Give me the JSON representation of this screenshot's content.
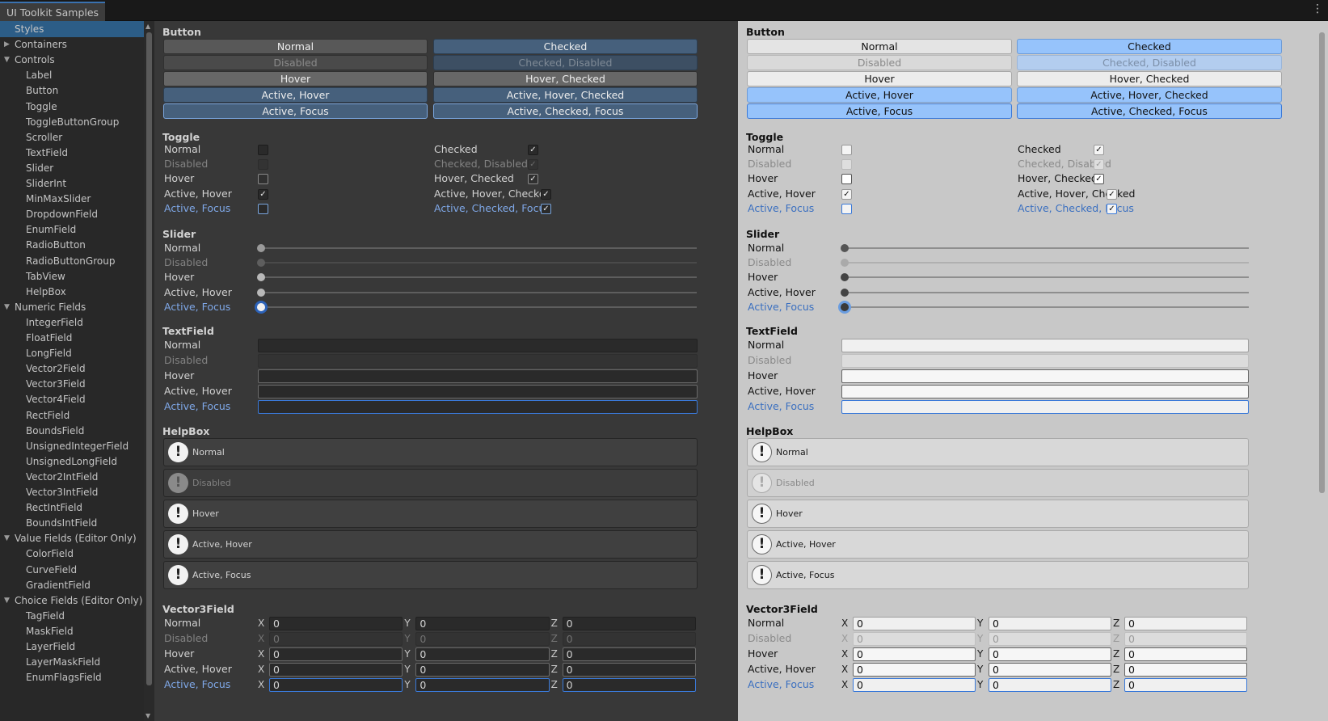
{
  "window": {
    "tab_title": "UI Toolkit Samples",
    "menu_icon": "kebab-menu-icon"
  },
  "sidebar": {
    "items": [
      {
        "label": "Styles",
        "level": 1,
        "selected": true,
        "arrow": ""
      },
      {
        "label": "Containers",
        "level": 1,
        "arrow": "▶"
      },
      {
        "label": "Controls",
        "level": 1,
        "arrow": "▼"
      },
      {
        "label": "Label",
        "level": 2
      },
      {
        "label": "Button",
        "level": 2
      },
      {
        "label": "Toggle",
        "level": 2
      },
      {
        "label": "ToggleButtonGroup",
        "level": 2
      },
      {
        "label": "Scroller",
        "level": 2
      },
      {
        "label": "TextField",
        "level": 2
      },
      {
        "label": "Slider",
        "level": 2
      },
      {
        "label": "SliderInt",
        "level": 2
      },
      {
        "label": "MinMaxSlider",
        "level": 2
      },
      {
        "label": "DropdownField",
        "level": 2
      },
      {
        "label": "EnumField",
        "level": 2
      },
      {
        "label": "RadioButton",
        "level": 2
      },
      {
        "label": "RadioButtonGroup",
        "level": 2
      },
      {
        "label": "TabView",
        "level": 2
      },
      {
        "label": "HelpBox",
        "level": 2
      },
      {
        "label": "Numeric Fields",
        "level": 1,
        "arrow": "▼"
      },
      {
        "label": "IntegerField",
        "level": 2
      },
      {
        "label": "FloatField",
        "level": 2
      },
      {
        "label": "LongField",
        "level": 2
      },
      {
        "label": "Vector2Field",
        "level": 2
      },
      {
        "label": "Vector3Field",
        "level": 2
      },
      {
        "label": "Vector4Field",
        "level": 2
      },
      {
        "label": "RectField",
        "level": 2
      },
      {
        "label": "BoundsField",
        "level": 2
      },
      {
        "label": "UnsignedIntegerField",
        "level": 2
      },
      {
        "label": "UnsignedLongField",
        "level": 2
      },
      {
        "label": "Vector2IntField",
        "level": 2
      },
      {
        "label": "Vector3IntField",
        "level": 2
      },
      {
        "label": "RectIntField",
        "level": 2
      },
      {
        "label": "BoundsIntField",
        "level": 2
      },
      {
        "label": "Value Fields (Editor Only)",
        "level": 1,
        "arrow": "▼"
      },
      {
        "label": "ColorField",
        "level": 2
      },
      {
        "label": "CurveField",
        "level": 2
      },
      {
        "label": "GradientField",
        "level": 2
      },
      {
        "label": "Choice Fields (Editor Only)",
        "level": 1,
        "arrow": "▼"
      },
      {
        "label": "TagField",
        "level": 2
      },
      {
        "label": "MaskField",
        "level": 2
      },
      {
        "label": "LayerField",
        "level": 2
      },
      {
        "label": "LayerMaskField",
        "level": 2
      },
      {
        "label": "EnumFlagsField",
        "level": 2
      }
    ]
  },
  "sections": {
    "button": {
      "title": "Button",
      "left": [
        "Normal",
        "Disabled",
        "Hover",
        "Active, Hover",
        "Active, Focus"
      ],
      "right": [
        "Checked",
        "Checked, Disabled",
        "Hover, Checked",
        "Active, Hover, Checked",
        "Active, Checked, Focus"
      ]
    },
    "toggle": {
      "title": "Toggle",
      "left": [
        "Normal",
        "Disabled",
        "Hover",
        "Active, Hover",
        "Active, Focus"
      ],
      "left_checked": [
        false,
        false,
        false,
        true,
        false
      ],
      "right": [
        "Checked",
        "Checked, Disabled",
        "Hover, Checked",
        "Active, Hover, Checked",
        "Active, Checked, Focus"
      ],
      "check_glyph": "✓"
    },
    "slider": {
      "title": "Slider",
      "rows": [
        "Normal",
        "Disabled",
        "Hover",
        "Active, Hover",
        "Active, Focus"
      ],
      "value_fraction": 0
    },
    "textfield": {
      "title": "TextField",
      "rows": [
        "Normal",
        "Disabled",
        "Hover",
        "Active, Hover",
        "Active, Focus"
      ],
      "value": ""
    },
    "helpbox": {
      "title": "HelpBox",
      "rows": [
        "Normal",
        "Disabled",
        "Hover",
        "Active, Hover",
        "Active, Focus"
      ],
      "icon_glyph": "!",
      "icon_name": "warning-icon"
    },
    "vector3": {
      "title": "Vector3Field",
      "rows": [
        "Normal",
        "Disabled",
        "Hover",
        "Active, Hover",
        "Active, Focus"
      ],
      "axes": [
        "X",
        "Y",
        "Z"
      ],
      "value": "0"
    }
  },
  "colors": {
    "selection": "#2c5d87",
    "dark_bg": "#383838",
    "light_bg": "#c8c8c8",
    "focus_blue": "#3a79d8",
    "light_active": "#96c3fb"
  }
}
